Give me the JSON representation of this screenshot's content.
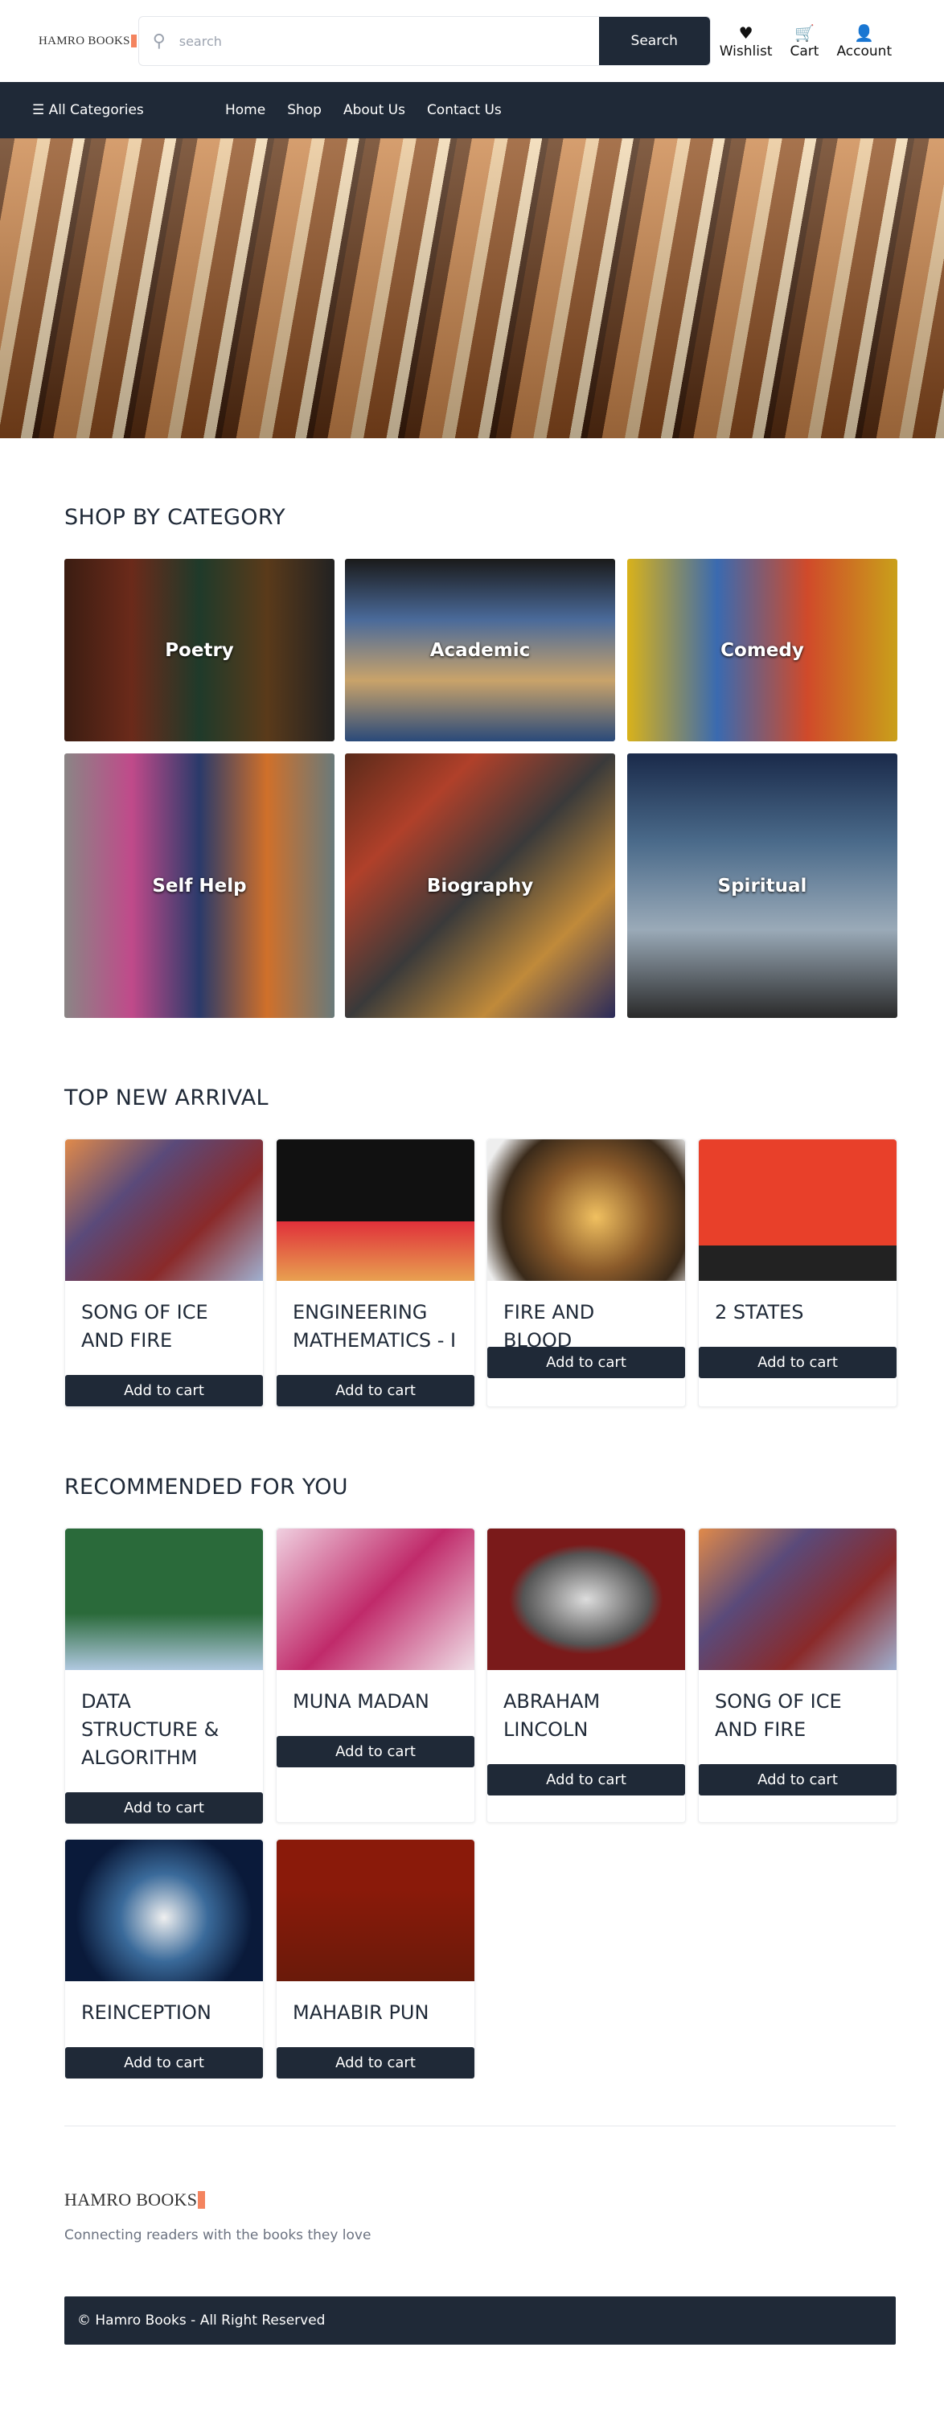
{
  "header": {
    "logo": "HAMRO BOOKS",
    "search_placeholder": "search",
    "search_button": "Search",
    "icons": [
      {
        "label": "Wishlist",
        "icon": "heart-icon"
      },
      {
        "label": "Cart",
        "icon": "cart-icon"
      },
      {
        "label": "Account",
        "icon": "person-icon"
      }
    ]
  },
  "nav": {
    "all_categories": "All Categories",
    "links": [
      "Home",
      "Shop",
      "About Us",
      "Contact Us"
    ]
  },
  "categories": {
    "title": "SHOP BY CATEGORY",
    "items": [
      "Poetry",
      "Academic",
      "Comedy",
      "Self Help",
      "Biography",
      "Spiritual"
    ]
  },
  "new_arrival": {
    "title": "TOP NEW ARRIVAL",
    "items": [
      "SONG OF ICE AND FIRE",
      "ENGINEERING MATHEMATICS - I",
      "FIRE AND BLOOD",
      "2 STATES"
    ]
  },
  "recommended": {
    "title": "RECOMMENDED FOR YOU",
    "items": [
      "DATA STRUCTURE & ALGORITHM",
      "MUNA MADAN",
      "ABRAHAM LINCOLN",
      "SONG OF ICE AND FIRE",
      "REINCEPTION",
      "MAHABIR PUN"
    ]
  },
  "add_to_cart": "Add to cart",
  "footer": {
    "logo": "HAMRO BOOKS",
    "tagline": "Connecting readers with the books they love",
    "copyright": "© Hamro Books - All Right Reserved"
  },
  "colors": {
    "primary": "#1f2937",
    "logo_accent": "#f4845f"
  }
}
